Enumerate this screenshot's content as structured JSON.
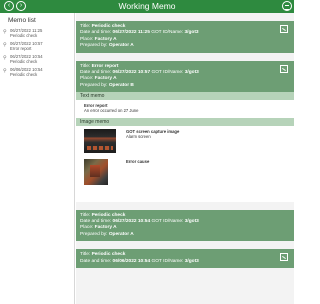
{
  "window": {
    "title": "Working Memo"
  },
  "sidebar": {
    "heading": "Memo list",
    "items": [
      {
        "date": "06/27/2022 11:25",
        "title": "Periodic check"
      },
      {
        "date": "06/27/2022 10:57",
        "title": "Error report"
      },
      {
        "date": "06/27/2022 10:54",
        "title": "Periodic check"
      },
      {
        "date": "06/06/2022 10:54",
        "title": "Periodic check"
      }
    ]
  },
  "labels": {
    "title": "Title: ",
    "datetime": "Date and time: ",
    "got_id": " GOT ID/Name: ",
    "place": "Place: ",
    "prepared": "Prepared by: "
  },
  "memos": [
    {
      "title": "Periodic check",
      "datetime": "06/27/2022 11:25",
      "got": "3/got3",
      "place": "Factory A",
      "prepared": "Operator A"
    },
    {
      "title": "Error report",
      "datetime": "06/27/2022 10:57",
      "got": "3/got3",
      "place": "Factory A",
      "prepared": "Operator B",
      "text_memo": {
        "label": "Text memo",
        "heading": "Error report",
        "body": "An error occurred on 27 June"
      },
      "image_memo": {
        "label": "Image memo",
        "images": [
          {
            "heading": "GOT screen capture image",
            "caption": "Alarm screen"
          },
          {
            "heading": "Error cause",
            "caption": ""
          }
        ]
      }
    },
    {
      "title": "Periodic check",
      "datetime": "06/27/2022 10:54",
      "got": "3/got3",
      "place": "Factory A",
      "prepared": "Operator A"
    },
    {
      "title": "Periodic check",
      "datetime": "06/06/2022 10:54",
      "got": "3/got3"
    }
  ]
}
